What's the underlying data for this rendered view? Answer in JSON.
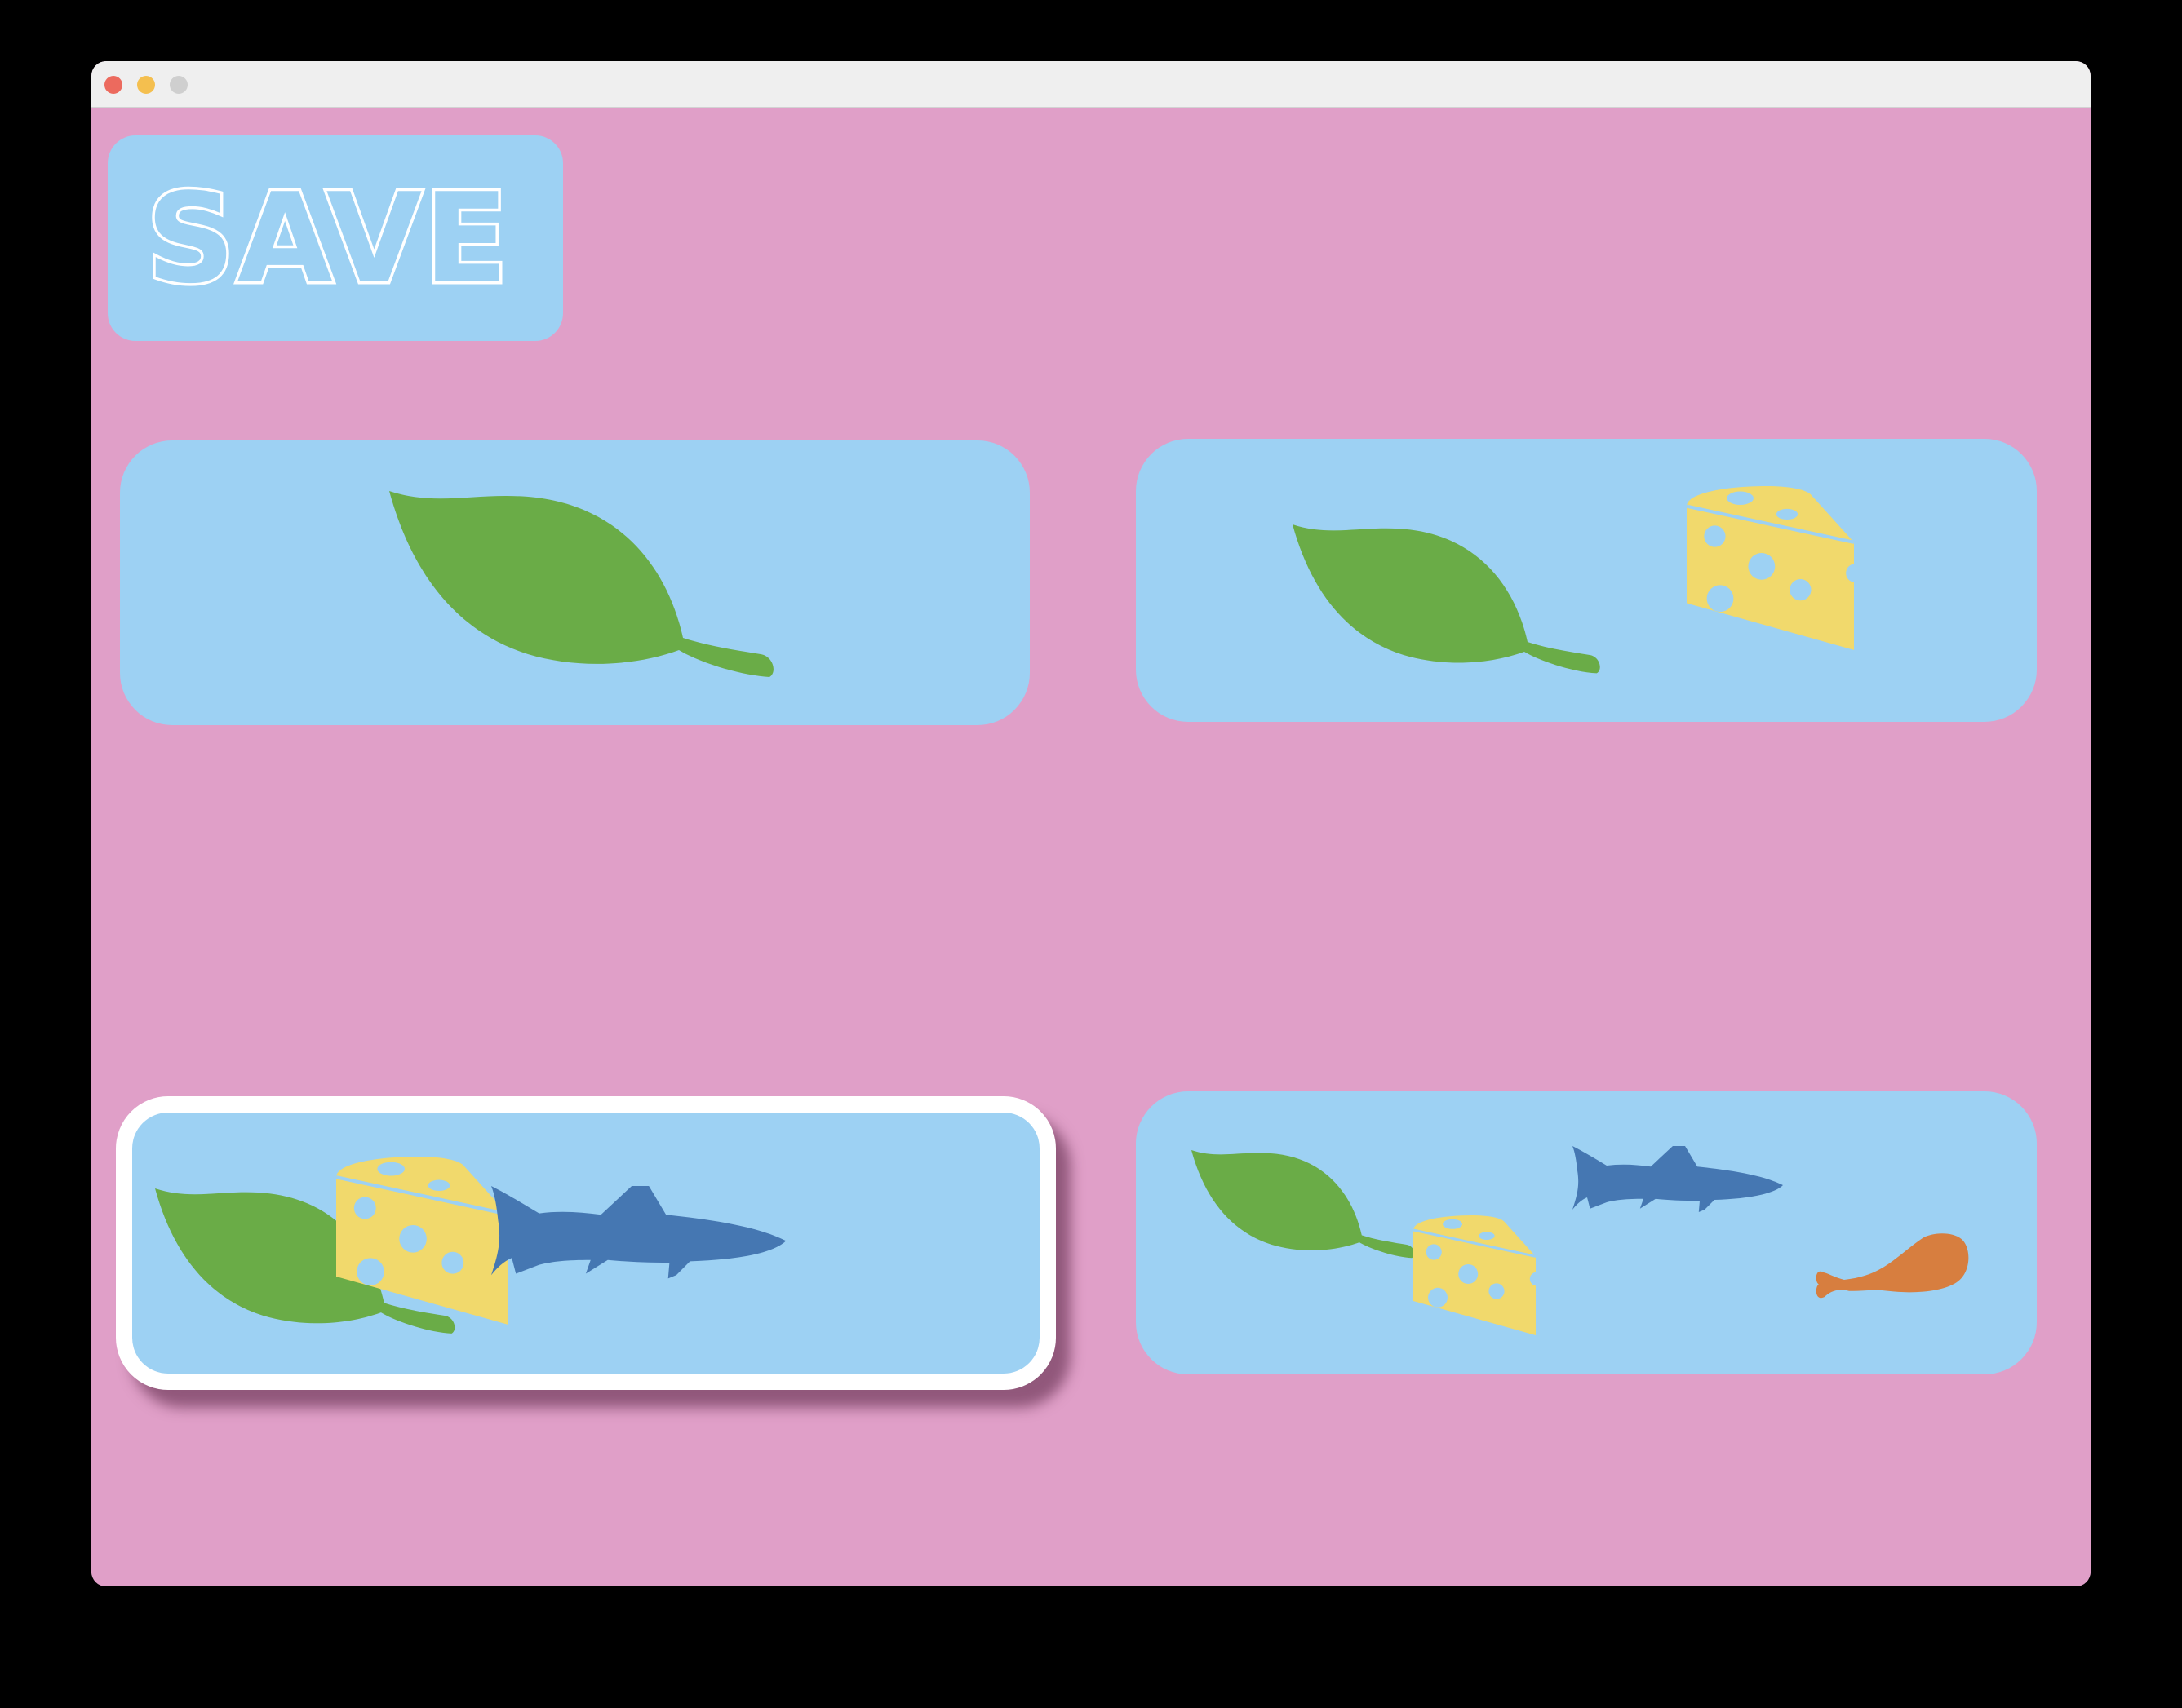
{
  "window": {
    "controls": [
      "close",
      "minimize",
      "zoom"
    ]
  },
  "toolbar": {
    "save_label": "SAVE"
  },
  "colors": {
    "background": "#E09FC8",
    "card": "#9DD1F3",
    "leaf": "#6AAC47",
    "cheese": "#F1D96C",
    "fish": "#4577B2",
    "drumstick": "#D77E3F",
    "selection_border": "#FFFFFF"
  },
  "options": [
    {
      "items": [
        "leaf-icon"
      ],
      "selected": false
    },
    {
      "items": [
        "leaf-icon",
        "cheese-icon"
      ],
      "selected": false
    },
    {
      "items": [
        "leaf-icon",
        "cheese-icon",
        "fish-icon"
      ],
      "selected": true
    },
    {
      "items": [
        "leaf-icon",
        "cheese-icon",
        "fish-icon",
        "drumstick-icon"
      ],
      "selected": false
    }
  ]
}
